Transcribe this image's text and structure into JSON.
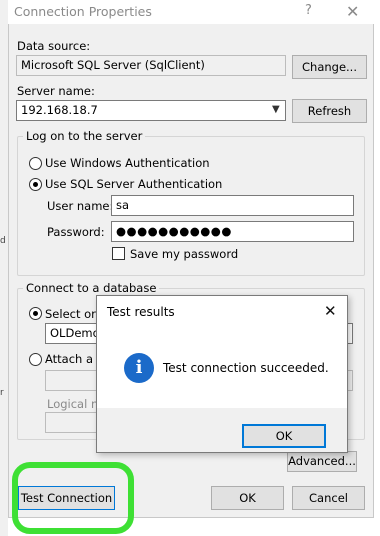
{
  "window": {
    "title": "Connection Properties",
    "help_glyph": "?",
    "close_glyph": "✕"
  },
  "data_source": {
    "label": "Data source:",
    "value": "Microsoft SQL Server (SqlClient)",
    "change_button": "Change..."
  },
  "server": {
    "label": "Server name:",
    "value": "192.168.18.7",
    "refresh_button": "Refresh"
  },
  "logon": {
    "group_title": "Log on to the server",
    "windows_auth": "Use Windows Authentication",
    "sql_auth": "Use SQL Server Authentication",
    "selected": "sql_auth",
    "username_label": "User name:",
    "username_value": "sa",
    "password_label": "Password:",
    "password_value": "●●●●●●●●●●●",
    "save_password": "Save my password",
    "save_password_checked": false
  },
  "database": {
    "group_title": "Connect to a database",
    "select_label": "Select or en",
    "select_value": "OLDemoF",
    "attach_label": "Attach a da",
    "logical_name_label": "Logical nam",
    "advanced_button": "Advanced..."
  },
  "footer": {
    "test_connection": "Test Connection",
    "ok": "OK",
    "cancel": "Cancel"
  },
  "test_results": {
    "title": "Test results",
    "close_glyph": "✕",
    "icon_glyph": "i",
    "message": "Test connection succeeded.",
    "ok": "OK"
  },
  "highlight_color": "#3ee034",
  "accent_color": "#0078d7"
}
